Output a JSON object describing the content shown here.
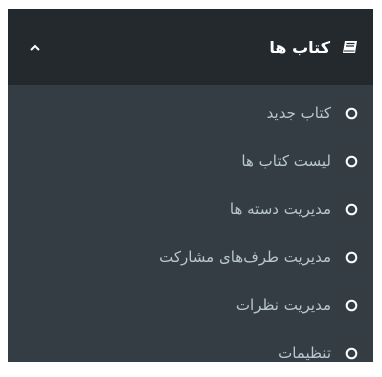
{
  "menu": {
    "title": "کتاب ها",
    "icon": "book-icon",
    "expanded_icon": "chevron-up-icon",
    "colors": {
      "header_bg": "#24292d",
      "submenu_bg": "#343d44",
      "header_text": "#ffffff",
      "item_text": "#b8c7ce"
    },
    "items": [
      {
        "label": "کتاب جدید",
        "icon": "circle-icon"
      },
      {
        "label": "لیست کتاب ها",
        "icon": "circle-icon"
      },
      {
        "label": "مدیریت دسته ها",
        "icon": "circle-icon"
      },
      {
        "label": "مدیریت طرف‌های مشارکت",
        "icon": "circle-icon"
      },
      {
        "label": "مدیریت نظرات",
        "icon": "circle-icon"
      },
      {
        "label": "تنظیمات",
        "icon": "circle-icon"
      }
    ]
  }
}
